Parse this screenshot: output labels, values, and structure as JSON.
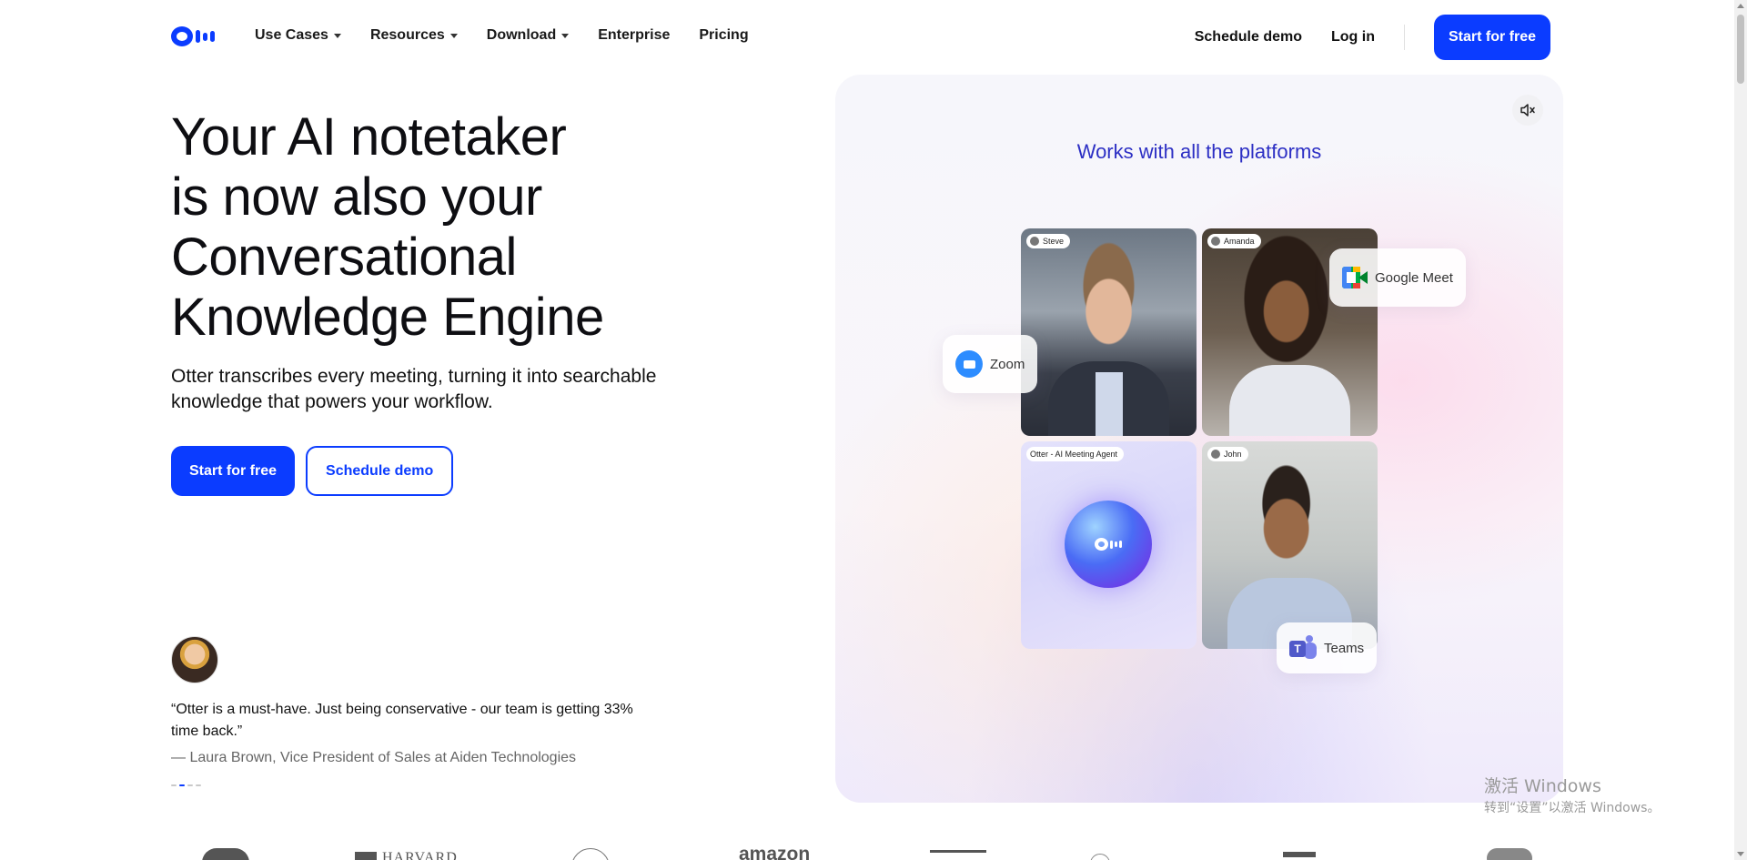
{
  "brand": {
    "accent": "#0b3cff",
    "panel_title_color": "#2c2fc4"
  },
  "nav": {
    "items": [
      {
        "label": "Use Cases",
        "dropdown": true
      },
      {
        "label": "Resources",
        "dropdown": true
      },
      {
        "label": "Download",
        "dropdown": true
      },
      {
        "label": "Enterprise",
        "dropdown": false
      },
      {
        "label": "Pricing",
        "dropdown": false
      }
    ],
    "schedule_demo": "Schedule demo",
    "log_in": "Log in",
    "start_free": "Start for free"
  },
  "hero": {
    "title_lines": [
      "Your AI notetaker",
      "is now also your",
      "Conversational",
      "Knowledge Engine"
    ],
    "subtitle": "Otter transcribes every meeting, turning it into searchable knowledge that powers your workflow.",
    "cta_primary": "Start for free",
    "cta_secondary": "Schedule demo"
  },
  "testimonial": {
    "quote": "“Otter is a must-have. Just being conservative - our team is getting 33% time back.”",
    "attribution": "— Laura Brown, Vice President of Sales at Aiden Technologies"
  },
  "panel": {
    "title": "Works with all the platforms",
    "mute_icon": "speaker-muted-icon",
    "participants": {
      "steve": "Steve",
      "amanda": "Amanda",
      "otter": "Otter - AI Meeting Agent",
      "john": "John"
    },
    "platforms": {
      "zoom": "Zoom",
      "meet": "Google Meet",
      "teams": "Teams"
    }
  },
  "watermark": {
    "line1": "激活 Windows",
    "line2": "转到“设置”以激活 Windows。"
  },
  "logo_strip": {
    "harvard": "HARVARD",
    "amazon": "amazon"
  }
}
